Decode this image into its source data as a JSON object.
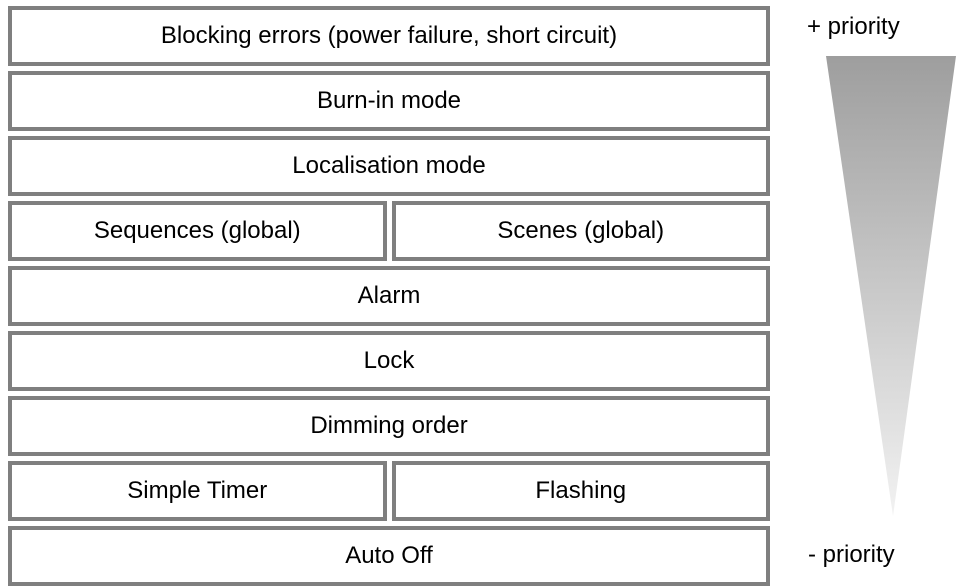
{
  "stack": {
    "rows": [
      [
        "Blocking errors (power failure, short circuit)"
      ],
      [
        "Burn-in mode"
      ],
      [
        "Localisation mode"
      ],
      [
        "Sequences (global)",
        "Scenes (global)"
      ],
      [
        "Alarm"
      ],
      [
        "Lock"
      ],
      [
        "Dimming order"
      ],
      [
        "Simple Timer",
        "Flashing"
      ],
      [
        "Auto Off"
      ]
    ]
  },
  "priority": {
    "high_label": "+ priority",
    "low_label": "- priority",
    "gradient_top_color": "#9e9e9e",
    "gradient_bottom_color": "#f2f2f2"
  }
}
